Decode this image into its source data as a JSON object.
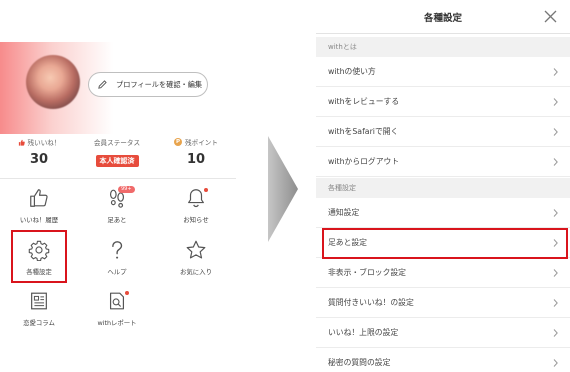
{
  "left_panel": {
    "profile_button": "プロフィールを確認・編集",
    "stats": [
      {
        "label": "残いいね！",
        "value": "30",
        "icon": "thumbs-up-icon"
      },
      {
        "label": "会員ステータス",
        "value": "本人確認済",
        "icon": ""
      },
      {
        "label": "残ポイント",
        "value": "10",
        "icon": "p-coin-icon",
        "icon_text": "P"
      }
    ],
    "menu": [
      {
        "label": "いいね！履歴",
        "icon": "thumbs-up-outline-icon"
      },
      {
        "label": "足あと",
        "icon": "footprints-icon",
        "badge": "99+"
      },
      {
        "label": "お知らせ",
        "icon": "bell-icon"
      },
      {
        "label": "各種設定",
        "icon": "gear-icon"
      },
      {
        "label": "ヘルプ",
        "icon": "question-mark-icon"
      },
      {
        "label": "お気に入り",
        "icon": "star-icon"
      },
      {
        "label": "恋愛コラム",
        "icon": "newspaper-icon"
      },
      {
        "label": "withレポート",
        "icon": "report-search-icon"
      }
    ]
  },
  "right_panel": {
    "title": "各種設定",
    "sections": [
      {
        "header": "withとは",
        "items": [
          "withの使い方",
          "withをレビューする",
          "withをSafariで開く",
          "withからログアウト"
        ]
      },
      {
        "header": "各種設定",
        "items": [
          "通知設定",
          "足あと設定",
          "非表示・ブロック設定",
          "質問付きいいね！の設定",
          "いいね！上限の設定",
          "秘密の質問の設定"
        ]
      }
    ]
  },
  "colors": {
    "highlight": "#d9141c",
    "badge_red": "#e74c3c",
    "point_orange": "#e8a44d",
    "section_bg": "#f1f1f1"
  }
}
